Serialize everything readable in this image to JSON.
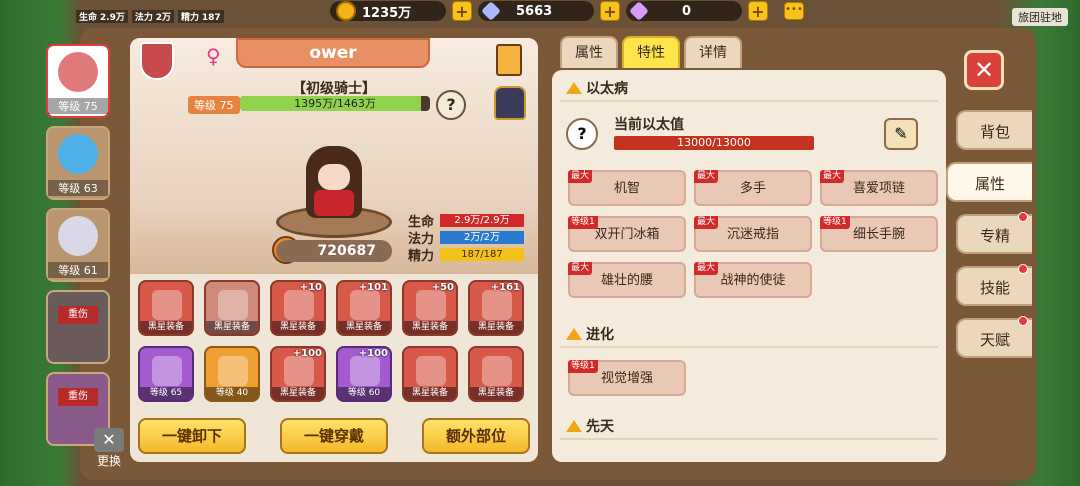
{
  "resources": {
    "gold": "1235万",
    "diamond": "5663",
    "gem": "0"
  },
  "hud": {
    "hp_label": "生命",
    "hp_val": "2.9万",
    "mp_label": "法力",
    "mp_val": "2万",
    "sp_label": "精力",
    "sp_val": "187"
  },
  "guild_label": "旅团驻地",
  "hero_tabs": [
    {
      "level": "等级 75"
    },
    {
      "level": "等级 63"
    },
    {
      "level": "等级 61"
    },
    {
      "level": "",
      "status": "重伤"
    },
    {
      "level": "",
      "status": "重伤"
    }
  ],
  "swap_label": "更换",
  "hero": {
    "name": "ower",
    "rank": "【初级骑士】",
    "level_tag": "等级 75",
    "hp_text": "1395万/1463万",
    "hp_fill": 0.953,
    "power": "720687",
    "stats": [
      {
        "label": "生命",
        "value": "2.9万/2.9万",
        "color": "#d02a2a"
      },
      {
        "label": "法力",
        "value": "2万/2万",
        "color": "#2a7ad0"
      },
      {
        "label": "精力",
        "value": "187/187",
        "color": "#f2c21b"
      }
    ]
  },
  "equipment": [
    {
      "label": "黑星装备",
      "plus": "",
      "style": "red"
    },
    {
      "label": "黑星装备",
      "plus": "",
      "style": "grey"
    },
    {
      "label": "黑星装备",
      "plus": "+10",
      "style": "red"
    },
    {
      "label": "黑星装备",
      "plus": "+101",
      "style": "red"
    },
    {
      "label": "黑星装备",
      "plus": "+50",
      "style": "red"
    },
    {
      "label": "黑星装备",
      "plus": "+161",
      "style": "red"
    },
    {
      "label": "等级 65",
      "plus": "",
      "style": "purple"
    },
    {
      "label": "等级 40",
      "plus": "",
      "style": "orange"
    },
    {
      "label": "黑星装备",
      "plus": "+100",
      "style": "red"
    },
    {
      "label": "等级 60",
      "plus": "+100",
      "style": "purple"
    },
    {
      "label": "黑星装备",
      "plus": "",
      "style": "red"
    },
    {
      "label": "黑星装备",
      "plus": "",
      "style": "red"
    }
  ],
  "actions": {
    "unequip": "一键卸下",
    "equip": "一键穿戴",
    "extra": "额外部位"
  },
  "right_tabs": {
    "attr": "属性",
    "trait": "特性",
    "detail": "详情"
  },
  "ether": {
    "section": "以太病",
    "current_label": "当前以太值",
    "value": "13000/13000"
  },
  "trait_groups": [
    {
      "title": "以太病",
      "items": [
        {
          "tag": "最大",
          "name": "机智"
        },
        {
          "tag": "最大",
          "name": "多手"
        },
        {
          "tag": "最大",
          "name": "喜爱项链"
        },
        {
          "tag": "等级1",
          "name": "双开门冰箱"
        },
        {
          "tag": "最大",
          "name": "沉迷戒指"
        },
        {
          "tag": "等级1",
          "name": "细长手腕"
        },
        {
          "tag": "最大",
          "name": "雄壮的腰"
        },
        {
          "tag": "最大",
          "name": "战神的使徒"
        }
      ]
    },
    {
      "title": "进化",
      "items": [
        {
          "tag": "等级1",
          "name": "视觉增强"
        }
      ]
    },
    {
      "title": "先天",
      "items": []
    }
  ],
  "side_nav": [
    {
      "label": "背包",
      "dot": false
    },
    {
      "label": "属性",
      "dot": false
    },
    {
      "label": "专精",
      "dot": true
    },
    {
      "label": "技能",
      "dot": true
    },
    {
      "label": "天赋",
      "dot": true
    }
  ]
}
